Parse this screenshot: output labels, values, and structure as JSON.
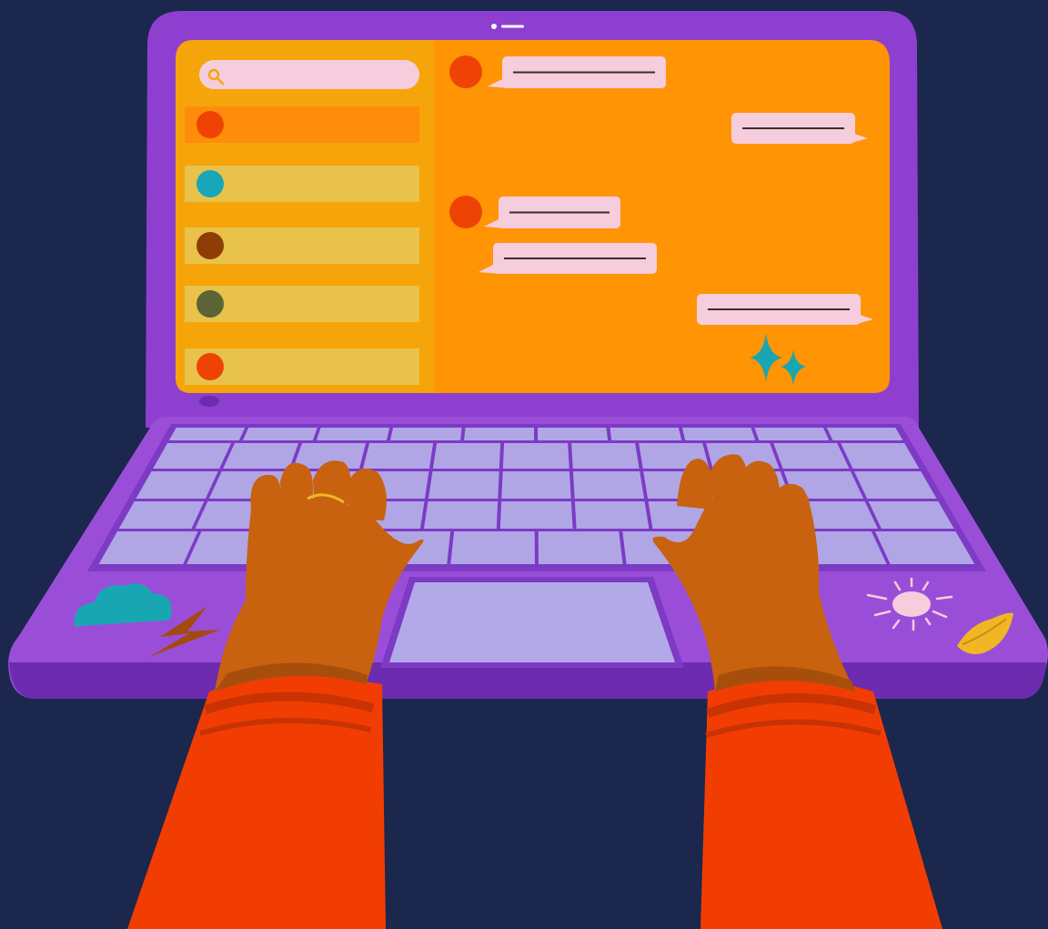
{
  "colors": {
    "background": "#1b274d",
    "laptop_frame": "#8e3fcf",
    "laptop_frame_dark": "#6d2bb0",
    "sidebar": "#f5a50a",
    "chat_area": "#ff9405",
    "contact_row": "#e8c24a",
    "contact_row_selected": "#ff8c0a",
    "search_bar": "#f6cddd",
    "bubble": "#f6cddd",
    "bubble_line": "#3b2e2e",
    "keyboard_deck": "#9a4ed8",
    "key": "#b0a6e6",
    "trackpad": "#b3a9e8",
    "skin": "#c8620f",
    "skin_shadow": "#a84e0c",
    "sleeve": "#f23d02",
    "sleeve_stripe": "#c73303",
    "sparkle": "#18a6b3",
    "cloud": "#18a6b3",
    "bolt": "#a4490f",
    "sun": "#f6cddd",
    "lips": "#f1b623"
  },
  "icons": {
    "search": "search-icon",
    "webcam": "webcam-icon",
    "sparkles": "sparkles-icon",
    "cloud_sticker": "cloud-icon",
    "bolt_sticker": "lightning-bolt-icon",
    "sun_sticker": "sun-icon",
    "lips_sticker": "lips-icon"
  },
  "contacts": [
    {
      "avatar_color": "#ef4305",
      "selected": true
    },
    {
      "avatar_color": "#17a7b8",
      "selected": false
    },
    {
      "avatar_color": "#8e3d06",
      "selected": false
    },
    {
      "avatar_color": "#5a6436",
      "selected": false
    },
    {
      "avatar_color": "#ef4305",
      "selected": false
    }
  ],
  "messages": [
    {
      "direction": "incoming",
      "avatar_color": "#ef4305",
      "has_avatar": true
    },
    {
      "direction": "outgoing",
      "has_avatar": false
    },
    {
      "direction": "incoming",
      "avatar_color": "#ef4305",
      "has_avatar": true
    },
    {
      "direction": "incoming",
      "has_avatar": false
    },
    {
      "direction": "outgoing",
      "has_avatar": false
    }
  ]
}
